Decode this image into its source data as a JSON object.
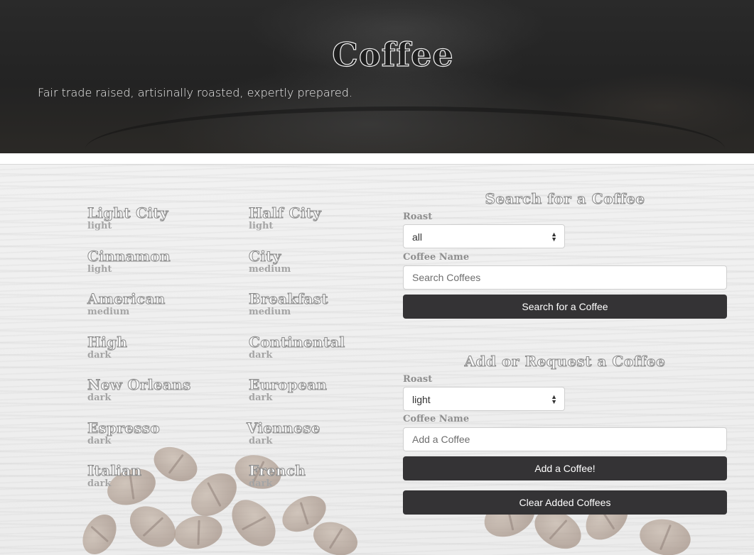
{
  "hero": {
    "title": "Coffee",
    "tagline": "Fair trade raised, artisinally roasted, expertly prepared."
  },
  "coffees": [
    {
      "name": "Light City",
      "roast": "light"
    },
    {
      "name": "Half City",
      "roast": "light"
    },
    {
      "name": "Cinnamon",
      "roast": "light"
    },
    {
      "name": "City",
      "roast": "medium"
    },
    {
      "name": "American",
      "roast": "medium"
    },
    {
      "name": "Breakfast",
      "roast": "medium"
    },
    {
      "name": "High",
      "roast": "dark"
    },
    {
      "name": "Continental",
      "roast": "dark"
    },
    {
      "name": "New Orleans",
      "roast": "dark"
    },
    {
      "name": "European",
      "roast": "dark"
    },
    {
      "name": "Espresso",
      "roast": "dark"
    },
    {
      "name": "Viennese",
      "roast": "dark"
    },
    {
      "name": "Italian",
      "roast": "dark"
    },
    {
      "name": "French",
      "roast": "dark"
    }
  ],
  "search": {
    "title": "Search for a Coffee",
    "roast_label": "Roast",
    "roast_value": "all",
    "name_label": "Coffee Name",
    "name_placeholder": "Search Coffees",
    "button_label": "Search for a Coffee"
  },
  "add": {
    "title": "Add or Request a Coffee",
    "roast_label": "Roast",
    "roast_value": "light",
    "name_label": "Coffee Name",
    "name_placeholder": "Add a Coffee",
    "button_label": "Add a Coffee!",
    "clear_label": "Clear Added Coffees"
  },
  "colors": {
    "button_bg": "#343335",
    "hero_bg": "#252525"
  }
}
